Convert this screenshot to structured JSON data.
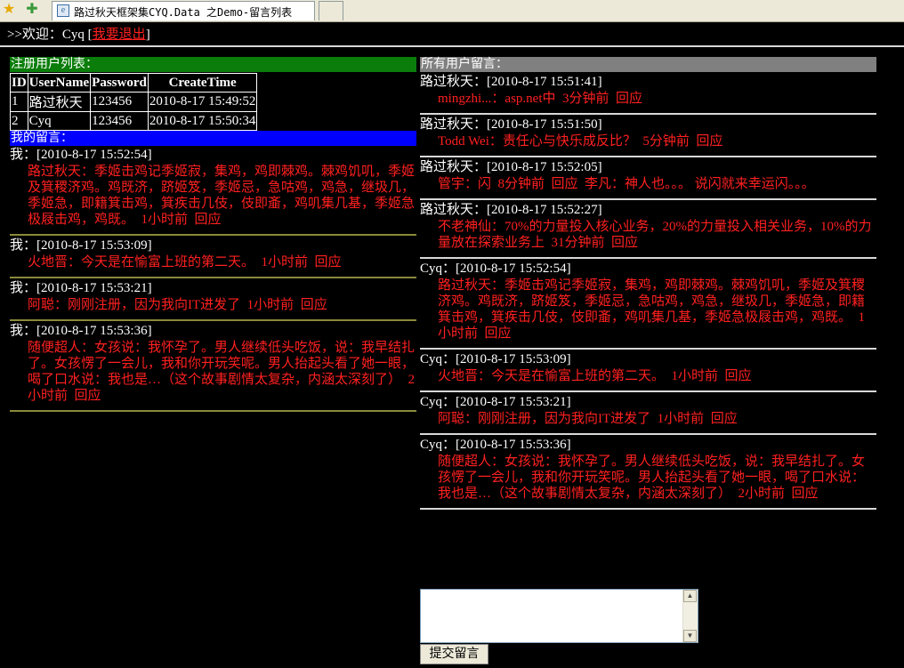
{
  "browser": {
    "tab_title": "路过秋天框架集CYQ.Data 之Demo-留言列表",
    "icons": [
      "star-icon",
      "add-favorite-icon",
      "page-icon"
    ]
  },
  "welcome": {
    "prefix": ">>欢迎：Cyq [",
    "logout": "我要退出",
    "suffix": "]"
  },
  "users": {
    "header": "注册用户列表：",
    "columns": [
      "ID",
      "UserName",
      "Password",
      "CreateTime"
    ],
    "rows": [
      [
        "1",
        "路过秋天",
        "123456",
        "2010-8-17 15:49:52"
      ],
      [
        "2",
        "Cyq",
        "123456",
        "2010-8-17 15:50:34"
      ]
    ]
  },
  "my_messages": {
    "header": "我的留言：",
    "items": [
      {
        "who": "我：[2010-8-17 15:52:54]",
        "text": "路过秋天：季姬击鸡记季姬寂，集鸡，鸡即棘鸡。棘鸡饥叽，季姬及箕稷济鸡。鸡既济，跻姬笈，季姬忌，急咕鸡，鸡急，继圾几，季姬急，即籍箕击鸡，箕疾击几伎，伎即齑，鸡叽集几基，季姬急极屐击鸡，鸡既。",
        "time": "1小时前",
        "reply": "回应"
      },
      {
        "who": "我：[2010-8-17 15:53:09]",
        "text": "火地晋：今天是在愉富上班的第二天。",
        "time": "1小时前",
        "reply": "回应"
      },
      {
        "who": "我：[2010-8-17 15:53:21]",
        "text": "阿聪：刚刚注册，因为我向IT进发了",
        "time": "1小时前",
        "reply": "回应"
      },
      {
        "who": "我：[2010-8-17 15:53:36]",
        "text": "随便超人：女孩说：我怀孕了。男人继续低头吃饭，说：我早结扎了。女孩愣了一会儿，我和你开玩笑呢。男人抬起头看了她一眼，喝了口水说：我也是…（这个故事剧情太复杂，内涵太深刻了）",
        "time": "2小时前",
        "reply": "回应"
      }
    ]
  },
  "all_messages": {
    "header": "所有用户留言：",
    "items": [
      {
        "who": "路过秋天：[2010-8-17 15:51:41]",
        "text": "mingzhi...：asp.net中",
        "time": "3分钟前",
        "reply": "回应",
        "extra": ""
      },
      {
        "who": "路过秋天：[2010-8-17 15:51:50]",
        "text": "Todd Wei：责任心与快乐成反比？",
        "time": "5分钟前",
        "reply": "回应",
        "extra": ""
      },
      {
        "who": "路过秋天：[2010-8-17 15:52:05]",
        "text": "管宇：闪",
        "time": "8分钟前",
        "reply": "回应",
        "extra": "李凡：神人也。。。 说闪就来幸运闪。。。"
      },
      {
        "who": "路过秋天：[2010-8-17 15:52:27]",
        "text": "不老神仙：70%的力量投入核心业务，20%的力量投入相关业务，10%的力量放在探索业务上",
        "time": "31分钟前",
        "reply": "回应",
        "extra": ""
      },
      {
        "who": "Cyq：[2010-8-17 15:52:54]",
        "text": "路过秋天：季姬击鸡记季姬寂，集鸡，鸡即棘鸡。棘鸡饥叽，季姬及箕稷济鸡。鸡既济，跻姬笈，季姬忌，急咕鸡，鸡急，继圾几，季姬急，即籍箕击鸡，箕疾击几伎，伎即齑，鸡叽集几基，季姬急极屐击鸡，鸡既。",
        "time": "1小时前",
        "reply": "回应",
        "extra": ""
      },
      {
        "who": "Cyq：[2010-8-17 15:53:09]",
        "text": "火地晋：今天是在愉富上班的第二天。",
        "time": "1小时前",
        "reply": "回应",
        "extra": ""
      },
      {
        "who": "Cyq：[2010-8-17 15:53:21]",
        "text": "阿聪：刚刚注册，因为我向IT进发了",
        "time": "1小时前",
        "reply": "回应",
        "extra": ""
      },
      {
        "who": "Cyq：[2010-8-17 15:53:36]",
        "text": "随便超人：女孩说：我怀孕了。男人继续低头吃饭，说：我早结扎了。女孩愣了一会儿，我和你开玩笑呢。男人抬起头看了她一眼，喝了口水说：我也是…（这个故事剧情太复杂，内涵太深刻了）",
        "time": "2小时前",
        "reply": "回应",
        "extra": ""
      }
    ]
  },
  "form": {
    "message_value": "",
    "submit_label": "提交留言"
  },
  "colors": {
    "background": "#000000",
    "message_text": "#ff2020",
    "users_header": "#0a7d0a",
    "my_header": "#0000ff",
    "all_header": "#808080"
  }
}
